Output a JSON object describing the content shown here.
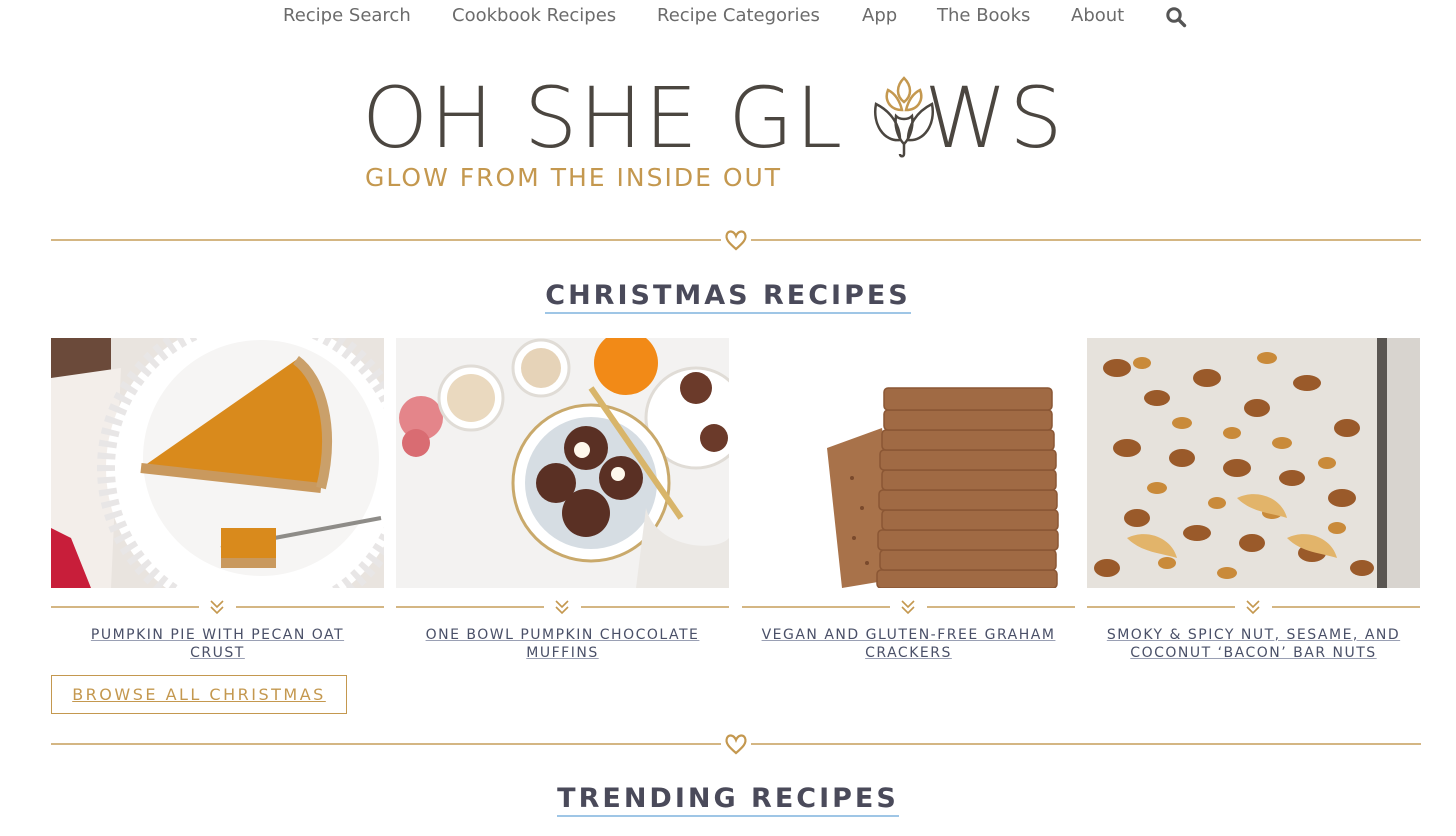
{
  "nav": {
    "items": [
      "Recipe Search",
      "Cookbook Recipes",
      "Recipe Categories",
      "App",
      "The Books",
      "About"
    ],
    "search_icon": "search-icon"
  },
  "logo": {
    "title_part1": "OH SHE GL",
    "title_part2": "WS",
    "tagline": "GLOW FROM THE INSIDE OUT",
    "art_icon": "artichoke-icon"
  },
  "sections": {
    "christmas_title": "CHRISTMAS RECIPES",
    "trending_title": "TRENDING RECIPES"
  },
  "cards": [
    {
      "title": "PUMPKIN PIE WITH PECAN OAT CRUST",
      "image": "pumpkin-pie-photo"
    },
    {
      "title": "ONE BOWL PUMPKIN CHOCOLATE MUFFINS",
      "image": "pumpkin-muffins-photo"
    },
    {
      "title": "VEGAN AND GLUTEN-FREE GRAHAM CRACKERS",
      "image": "graham-crackers-photo"
    },
    {
      "title": "SMOKY & SPICY NUT, SESAME, AND COCONUT ‘BACON’ BAR NUTS",
      "image": "bar-nuts-photo"
    }
  ],
  "browse_button": "BROWSE ALL CHRISTMAS",
  "colors": {
    "gold": "#c4984f",
    "divider": "#d4b683",
    "logo_text": "#4b4640",
    "heading_underline": "#9fc6e6"
  }
}
